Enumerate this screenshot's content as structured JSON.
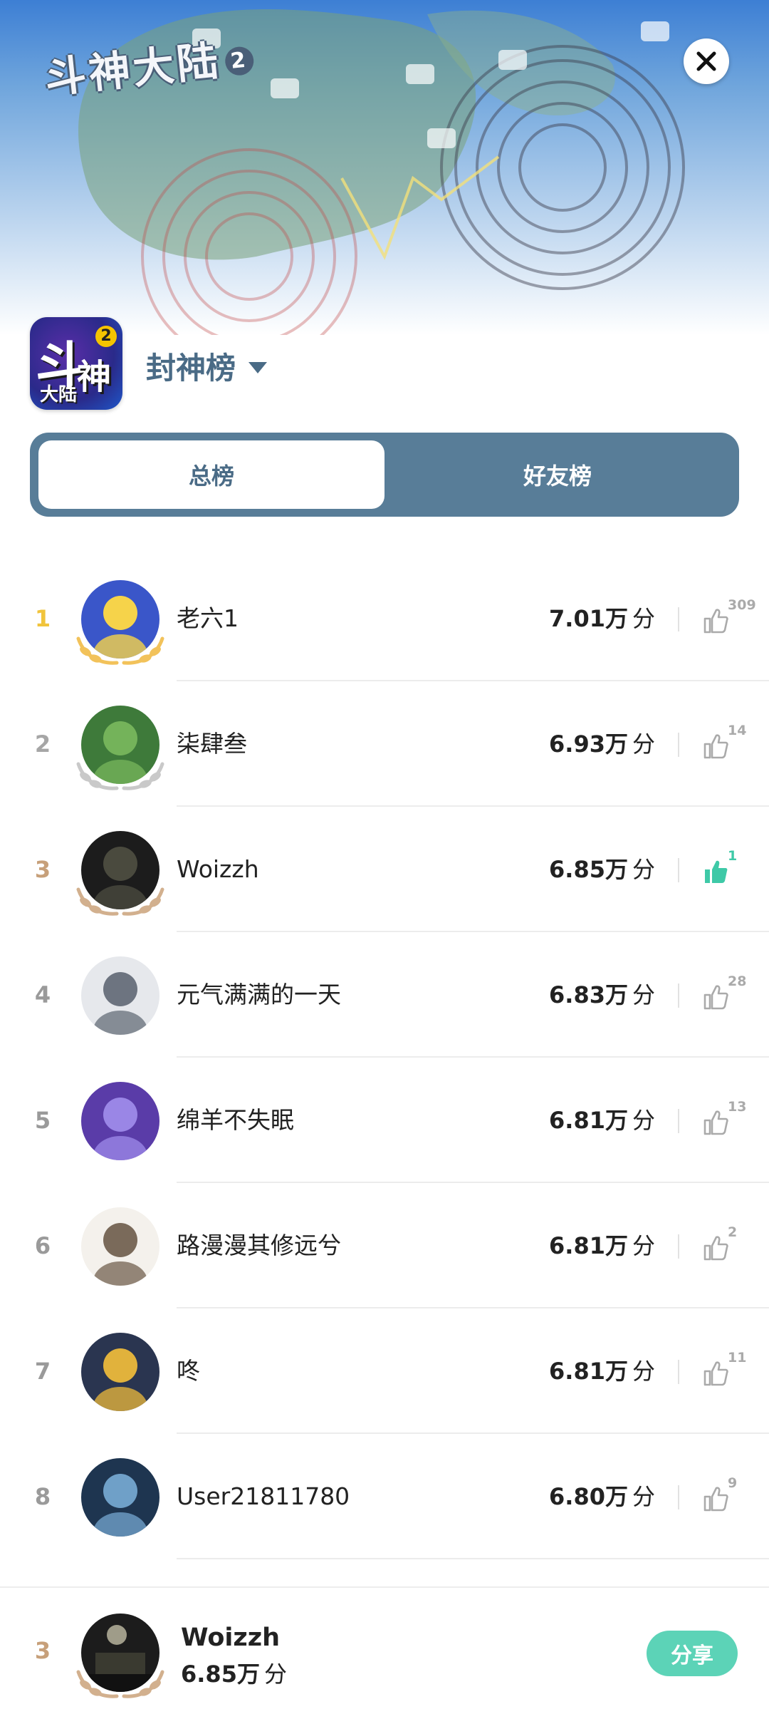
{
  "header": {
    "game_title": "斗神大陆",
    "game_title_num": "2",
    "close_icon": "close-icon"
  },
  "app": {
    "icon_main": "斗",
    "icon_second": "神",
    "icon_small": "大陆",
    "icon_badge": "2",
    "board_title": "封神榜"
  },
  "tabs": [
    {
      "label": "总榜",
      "active": true
    },
    {
      "label": "好友榜",
      "active": false
    }
  ],
  "score_unit": "分",
  "rows": [
    {
      "rank": "1",
      "name": "老六1",
      "score": "7.01万",
      "likes": "309",
      "liked": false,
      "rank_color": "#f1c43c",
      "laurel_color": "#f2c25a",
      "avatar_bg": "#3a56c9",
      "avatar_fg": "#f6d34a"
    },
    {
      "rank": "2",
      "name": "柒肆叁",
      "score": "6.93万",
      "likes": "14",
      "liked": false,
      "rank_color": "#a6a6a6",
      "laurel_color": "#c9c9c9",
      "avatar_bg": "#3e7a3a",
      "avatar_fg": "#74b35a"
    },
    {
      "rank": "3",
      "name": "Woizzh",
      "score": "6.85万",
      "likes": "1",
      "liked": true,
      "rank_color": "#c7a07a",
      "laurel_color": "#d2b08e",
      "avatar_bg": "#1c1c1c",
      "avatar_fg": "#4a4a3e"
    },
    {
      "rank": "4",
      "name": "元气满满的一天",
      "score": "6.83万",
      "likes": "28",
      "liked": false,
      "rank_color": "#9a9a9a",
      "laurel_color": "",
      "avatar_bg": "#e6e8ec",
      "avatar_fg": "#6d7480"
    },
    {
      "rank": "5",
      "name": "绵羊不失眠",
      "score": "6.81万",
      "likes": "13",
      "liked": false,
      "rank_color": "#9a9a9a",
      "laurel_color": "",
      "avatar_bg": "#5a3ca8",
      "avatar_fg": "#9a86e6"
    },
    {
      "rank": "6",
      "name": "路漫漫其修远兮",
      "score": "6.81万",
      "likes": "2",
      "liked": false,
      "rank_color": "#9a9a9a",
      "laurel_color": "",
      "avatar_bg": "#f4f1ec",
      "avatar_fg": "#7a6a5a"
    },
    {
      "rank": "7",
      "name": "咚",
      "score": "6.81万",
      "likes": "11",
      "liked": false,
      "rank_color": "#9a9a9a",
      "laurel_color": "",
      "avatar_bg": "#2a3550",
      "avatar_fg": "#e1b23c"
    },
    {
      "rank": "8",
      "name": "User21811780",
      "score": "6.80万",
      "likes": "9",
      "liked": false,
      "rank_color": "#9a9a9a",
      "laurel_color": "",
      "avatar_bg": "#1e3550",
      "avatar_fg": "#6fa0c8"
    }
  ],
  "me": {
    "rank": "3",
    "name": "Woizzh",
    "score": "6.85万",
    "share_label": "分享"
  }
}
